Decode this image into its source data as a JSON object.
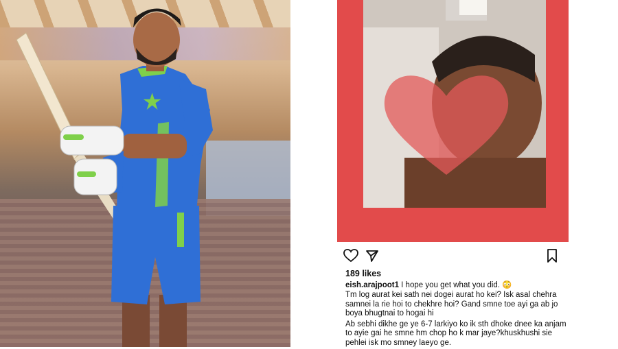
{
  "post": {
    "likes": "189 likes",
    "username": "eish.arajpoot1",
    "caption_text": " I hope you get what you did. 😳",
    "comment_1": "Tm log aurat kei sath nei dogei aurat ho kei? Isk asal chehra samnei la rie hoi to chekhre hoi? Gand smne toe ayi ga ab jo boya bhugtnai to hogai hi",
    "comment_2": "Ab sebhi dikhe ge ye 6-7 larkiyo ko ik sth dhoke dnee ka anjam to ayie gai he smne hm chop ho k mar jaye?khuskhushi sie pehlei isk mo smney laeyo ge."
  },
  "icons": {
    "like": "heart-icon",
    "share": "send-icon",
    "save": "bookmark-icon"
  },
  "colors": {
    "frame": "#e24b4b",
    "jersey": "#2f6fd6",
    "jersey_accent": "#7fd04a"
  }
}
